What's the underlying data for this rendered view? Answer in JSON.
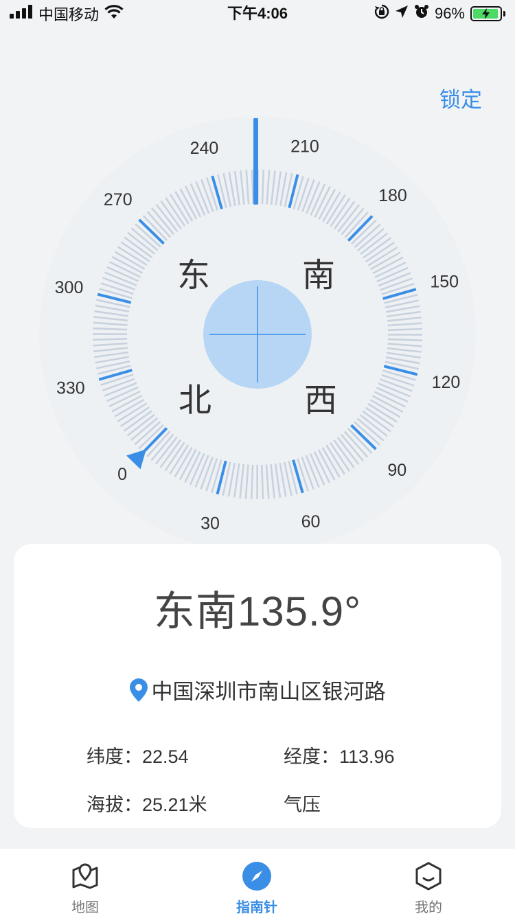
{
  "status_bar": {
    "carrier": "中国移动",
    "time": "下午4:06",
    "battery_percent": "96%",
    "battery_level": 0.96
  },
  "lock_label": "锁定",
  "compass": {
    "heading_deg": 135.9,
    "degree_labels": [
      "0",
      "30",
      "60",
      "90",
      "120",
      "150",
      "180",
      "210",
      "240",
      "270",
      "300",
      "330"
    ],
    "direction_labels": {
      "east": "东",
      "south": "南",
      "north": "北",
      "west": "西"
    },
    "colors": {
      "tick": "#c8d2de",
      "major_tick": "#3a8ee6",
      "center": "#b7d6f5",
      "crosshair": "#3a8ee6"
    }
  },
  "info": {
    "direction": "东南",
    "degrees": "135.9°",
    "location": "中国深圳市南山区银河路",
    "latitude_label": "纬度：",
    "latitude_value": "22.54",
    "longitude_label": "经度：",
    "longitude_value": "113.96",
    "altitude_label": "海拔：",
    "altitude_value": "25.21米",
    "pressure_label": "气压"
  },
  "tabs": [
    {
      "label": "地图",
      "icon": "map-icon",
      "active": false
    },
    {
      "label": "指南针",
      "icon": "compass-icon",
      "active": true
    },
    {
      "label": "我的",
      "icon": "profile-icon",
      "active": false
    }
  ]
}
